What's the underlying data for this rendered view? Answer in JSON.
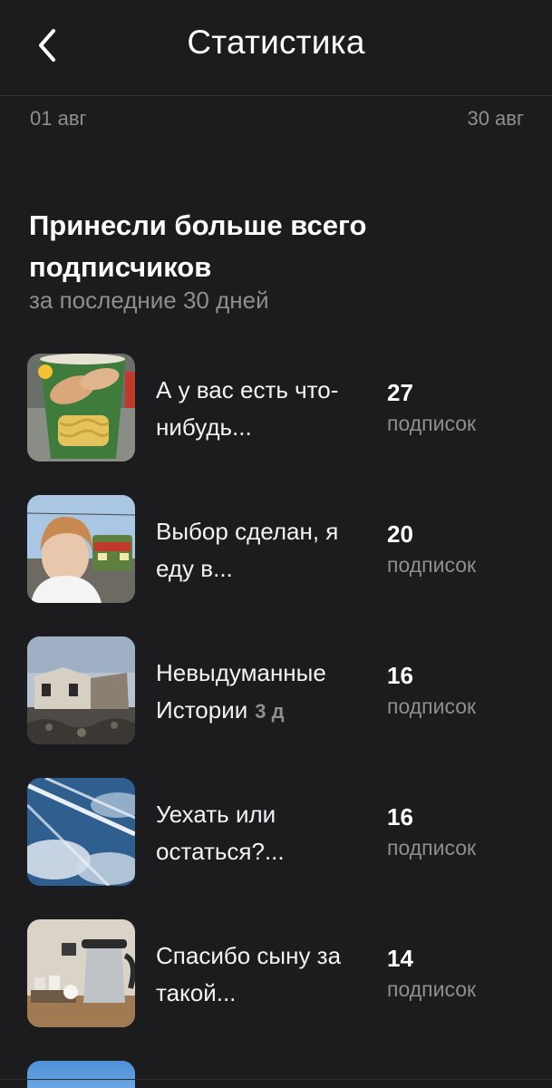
{
  "header": {
    "title": "Статистика",
    "back_icon": "chevron-left-icon"
  },
  "date_range": {
    "start": "01 авг",
    "end": "30 авг"
  },
  "section": {
    "title": "Принесли больше всего подписчиков",
    "subtitle": "за последние 30 дней"
  },
  "items": [
    {
      "title": "А у вас есть что-нибудь...",
      "age": "",
      "count": "27",
      "count_label": "подписок"
    },
    {
      "title": "Выбор сделан, я еду в...",
      "age": "",
      "count": "20",
      "count_label": "подписок"
    },
    {
      "title": "Невыдуманные Истории",
      "age": "3 д",
      "count": "16",
      "count_label": "подписок"
    },
    {
      "title": "Уехать или остаться?...",
      "age": "",
      "count": "16",
      "count_label": "подписок"
    },
    {
      "title": "Спасибо сыну за такой...",
      "age": "",
      "count": "14",
      "count_label": "подписок"
    }
  ],
  "colors": {
    "background": "#1c1c1e",
    "secondary_text": "#8e8e93",
    "primary_text": "#ffffff"
  }
}
